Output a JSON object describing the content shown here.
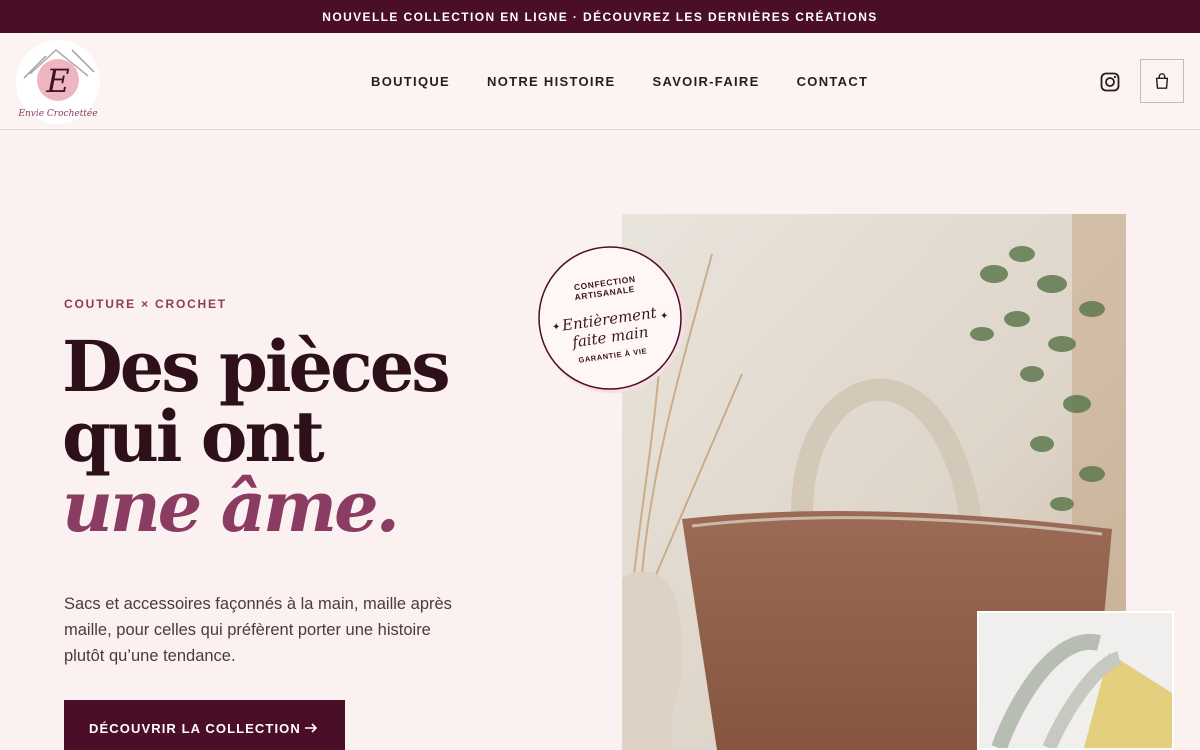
{
  "announcement": "NOUVELLE COLLECTION EN LIGNE · DÉCOUVREZ LES DERNIÈRES CRÉATIONS",
  "brand": {
    "logo_letter": "E",
    "logo_text": "Envie Crochettée"
  },
  "nav": [
    "BOUTIQUE",
    "NOTRE HISTOIRE",
    "SAVOIR-FAIRE",
    "CONTACT"
  ],
  "hero": {
    "eyebrow": "COUTURE × CROCHET",
    "headline_line1": "Des pièces",
    "headline_line2": "qui ont",
    "headline_line3": "une âme.",
    "description": "Sacs et accessoires façonnés à la main, maille après maille, pour celles qui préfèrent porter une histoire plutôt qu’une tendance.",
    "cta": "DÉCOUVRIR LA COLLECTION"
  },
  "badge": {
    "top": "CONFECTION ARTISANALE",
    "top_line1": "CONFECTION",
    "top_line2": "ARTISANALE",
    "script_line1": "Entièrement",
    "script_line2": "faite main",
    "bottom": "GARANTIE À VIE"
  },
  "icons": {
    "social": "instagram-icon",
    "cart": "shopping-bag-icon",
    "cta_arrow": "arrow-right-icon"
  },
  "colors": {
    "brand_dark": "#4a0e26",
    "accent": "#8a3c62",
    "background": "#fbf1f1"
  }
}
